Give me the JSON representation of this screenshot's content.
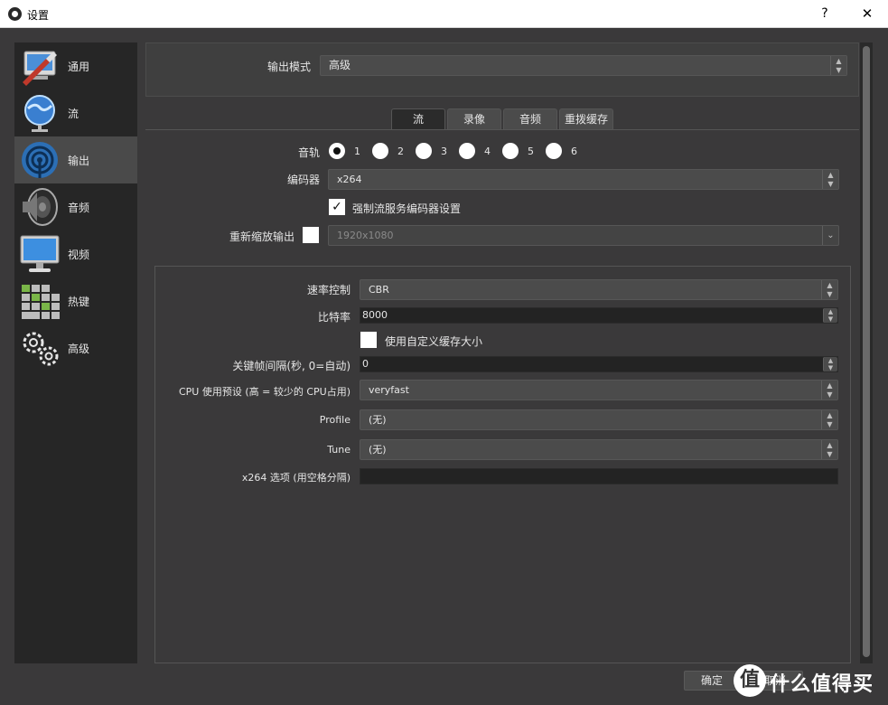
{
  "window": {
    "title": "设置",
    "help": "?",
    "close": "✕"
  },
  "sidebar": {
    "items": [
      {
        "label": "通用",
        "icon": "general-settings-icon"
      },
      {
        "label": "流",
        "icon": "stream-globe-icon"
      },
      {
        "label": "输出",
        "icon": "output-antenna-icon",
        "selected": true
      },
      {
        "label": "音频",
        "icon": "speaker-icon"
      },
      {
        "label": "视频",
        "icon": "monitor-icon"
      },
      {
        "label": "热键",
        "icon": "keyboard-icon"
      },
      {
        "label": "高级",
        "icon": "gears-icon"
      }
    ]
  },
  "output_mode": {
    "label": "输出模式",
    "value": "高级"
  },
  "tabs": [
    "流",
    "录像",
    "音频",
    "重拨缓存"
  ],
  "stream": {
    "track_label": "音轨",
    "tracks": [
      "1",
      "2",
      "3",
      "4",
      "5",
      "6"
    ],
    "encoder_label": "编码器",
    "encoder_value": "x264",
    "enforce_label": "强制流服务编码器设置",
    "rescale_label": "重新缩放输出",
    "rescale_value": "1920x1080"
  },
  "encoder_settings": {
    "rate_control_label": "速率控制",
    "rate_control_value": "CBR",
    "bitrate_label": "比特率",
    "bitrate_value": "8000",
    "custom_buffer_label": "使用自定义缓存大小",
    "keyframe_label": "关键帧间隔(秒, 0=自动)",
    "keyframe_value": "0",
    "preset_label": "CPU 使用预设 (高 = 较少的 CPU占用)",
    "preset_value": "veryfast",
    "profile_label": "Profile",
    "profile_value": "(无)",
    "tune_label": "Tune",
    "tune_value": "(无)",
    "x264opts_label": "x264 选项 (用空格分隔)",
    "x264opts_value": ""
  },
  "buttons": {
    "ok": "确定",
    "cancel": "取消"
  },
  "watermark": {
    "badge": "值",
    "text": "什么值得买"
  }
}
